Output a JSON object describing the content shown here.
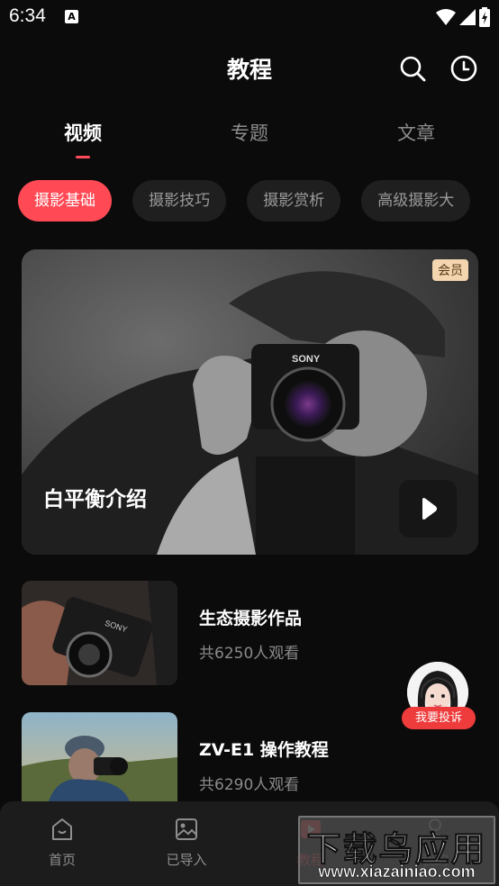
{
  "status_bar": {
    "time": "6:34",
    "notification_letter": "A"
  },
  "header": {
    "title": "教程",
    "search_icon": "search-icon",
    "history_icon": "clock-icon"
  },
  "tabs": [
    {
      "label": "视频",
      "active": true
    },
    {
      "label": "专题",
      "active": false
    },
    {
      "label": "文章",
      "active": false
    }
  ],
  "chips": [
    {
      "label": "摄影基础",
      "active": true
    },
    {
      "label": "摄影技巧",
      "active": false
    },
    {
      "label": "摄影赏析",
      "active": false
    },
    {
      "label": "高级摄影大",
      "active": false
    }
  ],
  "hero": {
    "badge": "会员",
    "title": "白平衡介绍",
    "camera_brand": "SONY"
  },
  "list": [
    {
      "title": "生态摄影作品",
      "views": "共6250人观看",
      "camera_brand": "SONY"
    },
    {
      "title": "ZV-E1 操作教程",
      "views": "共6290人观看"
    }
  ],
  "support": {
    "label": "我要投诉"
  },
  "bottom_nav": [
    {
      "label": "首页",
      "icon": "home-icon"
    },
    {
      "label": "已导入",
      "icon": "image-icon"
    },
    {
      "label": "教程",
      "icon": "tutorial-icon"
    },
    {
      "label": "我的",
      "icon": "profile-icon"
    }
  ],
  "watermark": {
    "cn": "下载鸟应用",
    "en": "www.xiazainiao.com"
  },
  "colors": {
    "accent": "#ff4a55",
    "background": "#0b0b0b",
    "chip_bg": "#1f1f1f",
    "nav_bg": "#1c1c1c",
    "badge_bg": "#f3d6b0"
  }
}
